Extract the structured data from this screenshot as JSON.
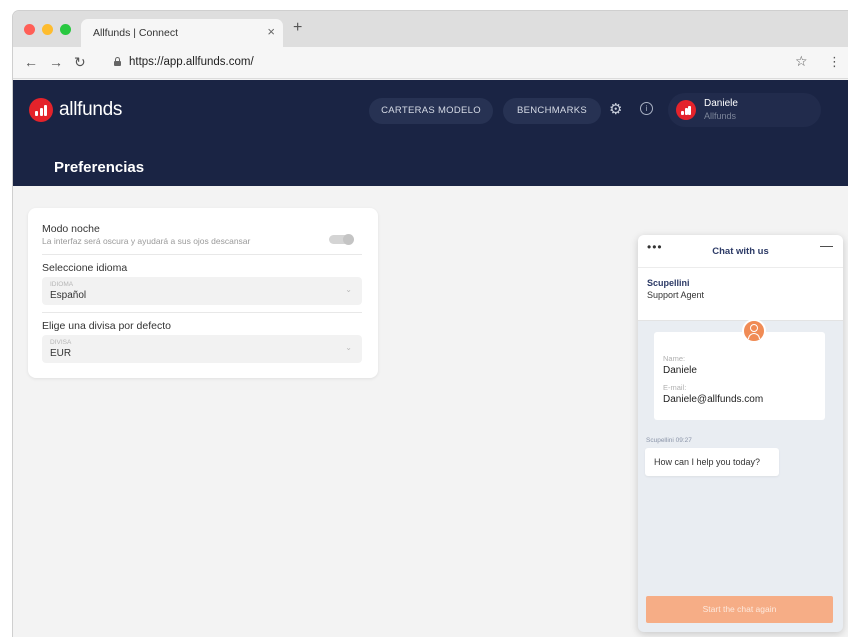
{
  "browser": {
    "tab_title": "Allfunds | Connect",
    "tab_close": "×",
    "new_tab": "+",
    "url": "https://app.allfunds.com/",
    "icons": {
      "back": "arrow-left-icon",
      "forward": "arrow-right-icon",
      "reload": "reload-icon",
      "lock": "lock-icon",
      "star": "star-icon",
      "menu": "kebab-menu-icon"
    }
  },
  "header": {
    "brand": "allfunds",
    "nav_buttons": [
      "CARTERAS MODELO",
      "BENCHMARKS"
    ],
    "settings_icon": "gear-icon",
    "info_icon": "info-icon",
    "user": {
      "name": "Daniele",
      "org": "Allfunds"
    },
    "page_title": "Preferencias",
    "colors": {
      "header_bg": "#1a2444",
      "brand_red": "#e4232b"
    }
  },
  "preferences": {
    "night_mode": {
      "label": "Modo noche",
      "hint": "La interfaz será oscura y ayudará a sus ojos descansar",
      "enabled": false
    },
    "language": {
      "label": "Seleccione idioma",
      "caption": "IDIOMA",
      "value": "Español"
    },
    "currency": {
      "label": "Elige una divisa por defecto",
      "caption": "DIVISA",
      "value": "EUR"
    }
  },
  "chat": {
    "menu": "•••",
    "title": "Chat with us",
    "minimize": "—",
    "agent_name": "Scupellini",
    "agent_role": "Support Agent",
    "name_label": "Name:",
    "name_value": "Daniele",
    "email_label": "E-mail:",
    "email_value": "Daniele@allfunds.com",
    "message_meta": "Scupellini 09:27",
    "message": "How can I help you today?",
    "restart_label": "Start the chat again",
    "colors": {
      "accent": "#f08b55",
      "button": "#f6ad86"
    }
  }
}
